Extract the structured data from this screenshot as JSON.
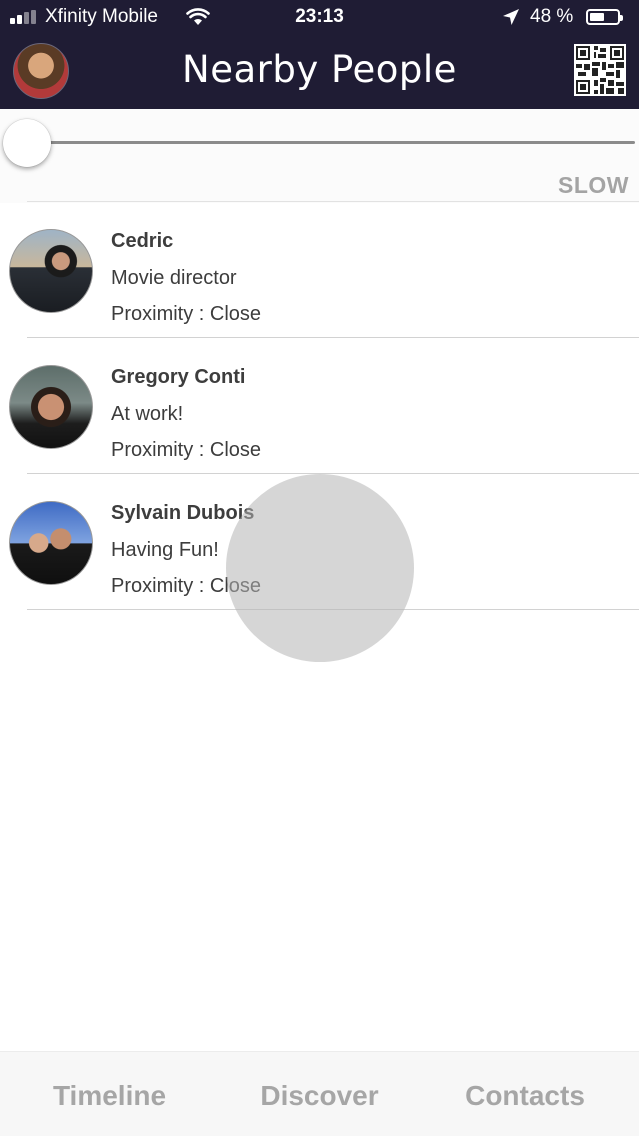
{
  "status_bar": {
    "carrier": "Xfinity Mobile",
    "time": "23:13",
    "battery": "48 %",
    "battery_level": 0.48
  },
  "header": {
    "title": "Nearby People",
    "qr_icon": "qr-code-icon"
  },
  "slider": {
    "speed_label": "SLOW",
    "value": 0
  },
  "people": [
    {
      "name": "Cedric",
      "status": "Movie director",
      "proximity": "Proximity : Close"
    },
    {
      "name": "Gregory Conti",
      "status": "At work!",
      "proximity": "Proximity : Close"
    },
    {
      "name": "Sylvain Dubois",
      "status": "Having Fun!",
      "proximity": "Proximity : Close"
    }
  ],
  "tabs": [
    "Timeline",
    "Discover",
    "Contacts"
  ],
  "colors": {
    "header_bg": "#1f1c34",
    "tab_text": "#a6a6a6",
    "text": "#3d3d3d"
  }
}
